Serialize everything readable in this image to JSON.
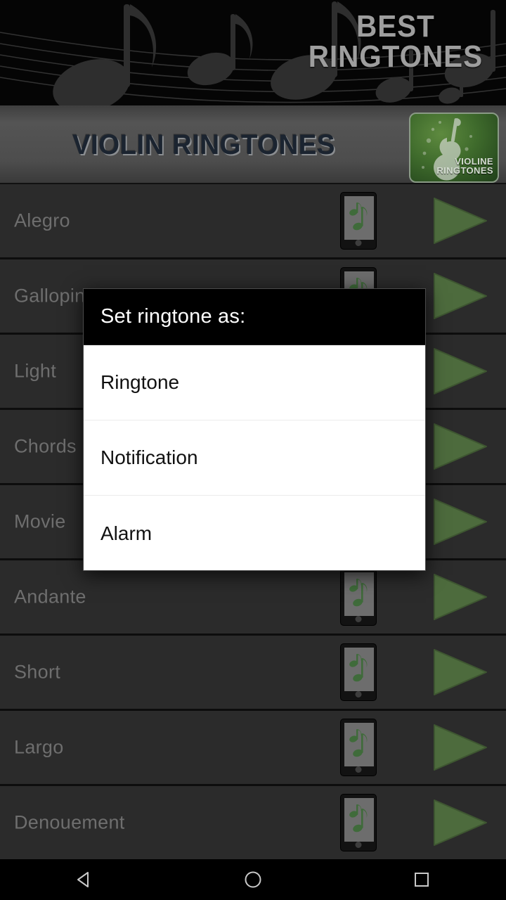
{
  "banner": {
    "line1": "BEST",
    "line2": "RINGTONES",
    "background_color": "#050505",
    "text_color": "#9e9e9e"
  },
  "header": {
    "title": "VIOLIN RINGTONES",
    "icon_label_line1": "VIOLINE",
    "icon_label_line2": "RINGTONES",
    "bar_color": "#4d4d4d",
    "icon_color": "#3f6b2c"
  },
  "list": {
    "row_color": "#2b2b2b",
    "label_color": "#6e6e6e",
    "play_color": "#4d6b3d",
    "items": [
      {
        "label": "Alegro"
      },
      {
        "label": "Galloping"
      },
      {
        "label": "Light"
      },
      {
        "label": "Chords"
      },
      {
        "label": "Movie"
      },
      {
        "label": "Andante"
      },
      {
        "label": "Short"
      },
      {
        "label": "Largo"
      },
      {
        "label": "Denouement"
      }
    ]
  },
  "dialog": {
    "title": "Set ringtone as:",
    "title_bg": "#000000",
    "body_bg": "#ffffff",
    "options": [
      {
        "label": "Ringtone"
      },
      {
        "label": "Notification"
      },
      {
        "label": "Alarm"
      }
    ]
  },
  "navbar": {
    "back": "back-triangle",
    "home": "home-circle",
    "recents": "recents-square"
  }
}
